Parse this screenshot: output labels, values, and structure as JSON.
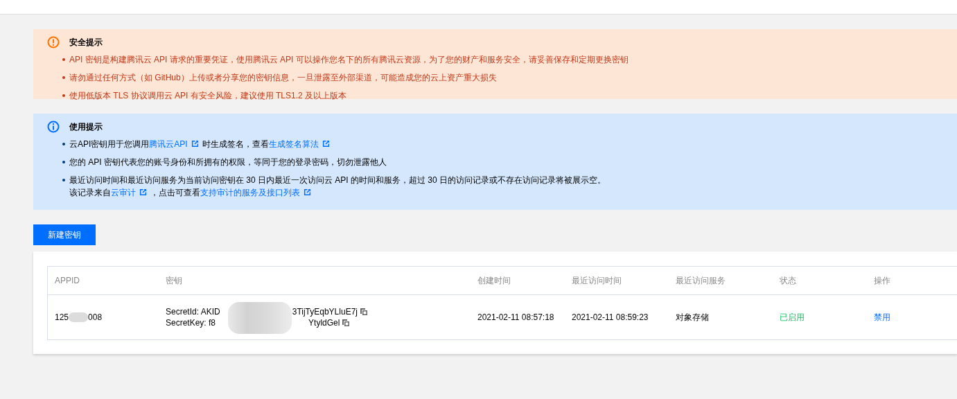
{
  "alerts": [
    {
      "kind": "warning",
      "title": "安全提示",
      "items": [
        [
          [
            {
              "text": "API 密钥是构建腾讯云 API 请求的重要凭证，使用腾讯云 API 可以操作您名下的所有腾讯云资源，为了您的财产和服务安全，请妥善保存和定期更换密钥",
              "link": false
            }
          ]
        ],
        [
          [
            {
              "text": "请勿通过任何方式（如 GitHub）上传或者分享您的密钥信息，一旦泄露至外部渠道，可能造成您的云上资产重大损失",
              "link": false
            }
          ]
        ],
        [
          [
            {
              "text": "使用低版本 TLS 协议调用云 API 有安全风险，建议使用 TLS1.2 及以上版本",
              "link": false
            }
          ]
        ]
      ]
    },
    {
      "kind": "info",
      "title": "使用提示",
      "items": [
        [
          [
            {
              "text": "云API密钥用于您调用",
              "link": false
            },
            {
              "text": "腾讯云API",
              "link": true
            },
            {
              "text": "时生成签名，查看",
              "link": false
            },
            {
              "text": "生成签名算法",
              "link": true
            }
          ]
        ],
        [
          [
            {
              "text": "您的 API 密钥代表您的账号身份和所拥有的权限，等同于您的登录密码，切勿泄露他人",
              "link": false
            }
          ]
        ],
        [
          [
            {
              "text": "最近访问时间和最近访问服务为当前访问密钥在 30 日内最近一次访问云 API 的时间和服务，超过 30 日的访问记录或不存在访问记录将被展示空。",
              "link": false
            }
          ],
          [
            {
              "text": "该记录来自",
              "link": false
            },
            {
              "text": "云审计",
              "link": true
            },
            {
              "text": "，点击可查看",
              "link": false
            },
            {
              "text": "支持审计的服务及接口列表",
              "link": true
            }
          ]
        ]
      ]
    }
  ],
  "create_button": "新建密钥",
  "table": {
    "columns": [
      "APPID",
      "密钥",
      "创建时间",
      "最近访问时间",
      "最近访问服务",
      "状态",
      "操作"
    ],
    "rows": [
      {
        "appid_start": "125",
        "appid_end": "008",
        "secret_id_start": "SecretId: AKID",
        "secret_id_end": "3TijTyEqbYLluE7j",
        "secret_key_start": "SecretKey: f8",
        "secret_key_end": "YtyldGel",
        "created": "2021-02-11 08:57:18",
        "last_access": "2021-02-11 08:59:23",
        "last_service": "对象存储",
        "status": {
          "text": "已启用",
          "kind": "enabled"
        },
        "action": "禁用"
      }
    ]
  }
}
